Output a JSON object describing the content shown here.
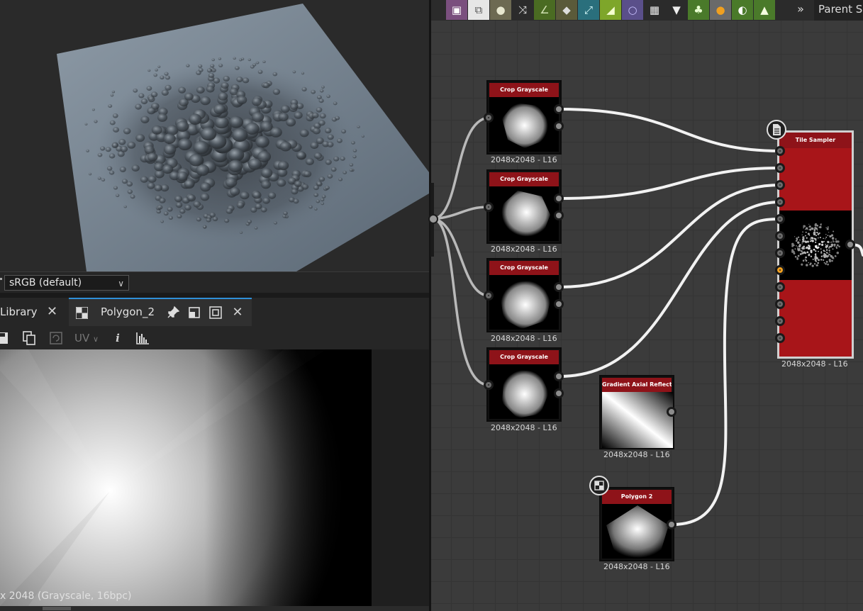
{
  "viewport_3d": {
    "color_space": "sRGB (default)"
  },
  "viewport_2d": {
    "tabs": [
      {
        "label": "Library"
      },
      {
        "label": "Polygon_2"
      }
    ],
    "toolbar": {
      "uv_label": "UV"
    },
    "image_info": "x 2048 (Grayscale, 16bpc)"
  },
  "graph": {
    "toolbar": {
      "tools": [
        "image-icon",
        "transform-icon",
        "blur-icon",
        "shuffle-icon",
        "curve-icon",
        "dropper-icon",
        "warp-icon",
        "gradient-icon",
        "circle-icon",
        "grid-icon",
        "download-icon",
        "watering-icon",
        "slider-icon",
        "contrast-icon",
        "histogram-icon"
      ],
      "more": "»",
      "parent_label": "Parent Si"
    },
    "nodes": [
      {
        "id": "crop1",
        "title": "Crop Grayscale",
        "caption": "2048x2048 - L16"
      },
      {
        "id": "crop2",
        "title": "Crop Grayscale",
        "caption": "2048x2048 - L16"
      },
      {
        "id": "crop3",
        "title": "Crop Grayscale",
        "caption": "2048x2048 - L16"
      },
      {
        "id": "crop4",
        "title": "Crop Grayscale",
        "caption": "2048x2048 - L16"
      },
      {
        "id": "gradient",
        "title": "Gradient Axial Reflected",
        "caption": "2048x2048 - L16"
      },
      {
        "id": "polygon",
        "title": "Polygon 2",
        "caption": "2048x2048 - L16"
      },
      {
        "id": "tile",
        "title": "Tile Sampler",
        "caption": "2048x2048 - L16"
      }
    ]
  },
  "colors": {
    "node_header": "#8e1319",
    "tile_body": "#a81519",
    "active_port": "#f0a020",
    "tab_accent": "#2f8fd8"
  }
}
